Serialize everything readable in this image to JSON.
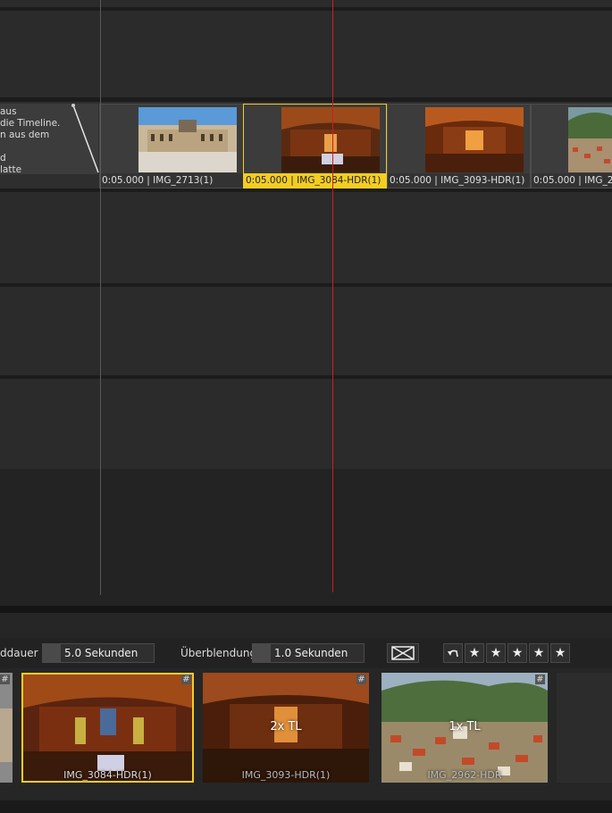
{
  "timeline": {
    "hint_lines": "aus\ndie Timeline.\nn aus dem\n\nd\nlatte",
    "slides": [
      {
        "label": "0:05.000 | IMG_2713(1)",
        "selected": false
      },
      {
        "label": "0:05.000 | IMG_3084-HDR(1)",
        "selected": true
      },
      {
        "label": "0:05.000 | IMG_3093-HDR(1)",
        "selected": false
      },
      {
        "label": "0:05.000 | IMG_2",
        "selected": false
      }
    ]
  },
  "toolbar": {
    "duration_label": "ddauer",
    "duration_value": "5.0 Sekunden",
    "transition_label": "Überblendung",
    "transition_value": "1.0 Sekunden",
    "stars": [
      "★",
      "★",
      "★",
      "★",
      "★"
    ]
  },
  "lightbox": {
    "items": [
      {
        "name": "IMG_3084-HDR(1)",
        "count": ""
      },
      {
        "name": "IMG_3093-HDR(1)",
        "count": "2x TL"
      },
      {
        "name": "IMG_2962-HDR",
        "count": "1x TL"
      }
    ],
    "hash_symbol": "#"
  },
  "colors": {
    "selection": "#f3cd22",
    "playhead": "#c82020"
  }
}
